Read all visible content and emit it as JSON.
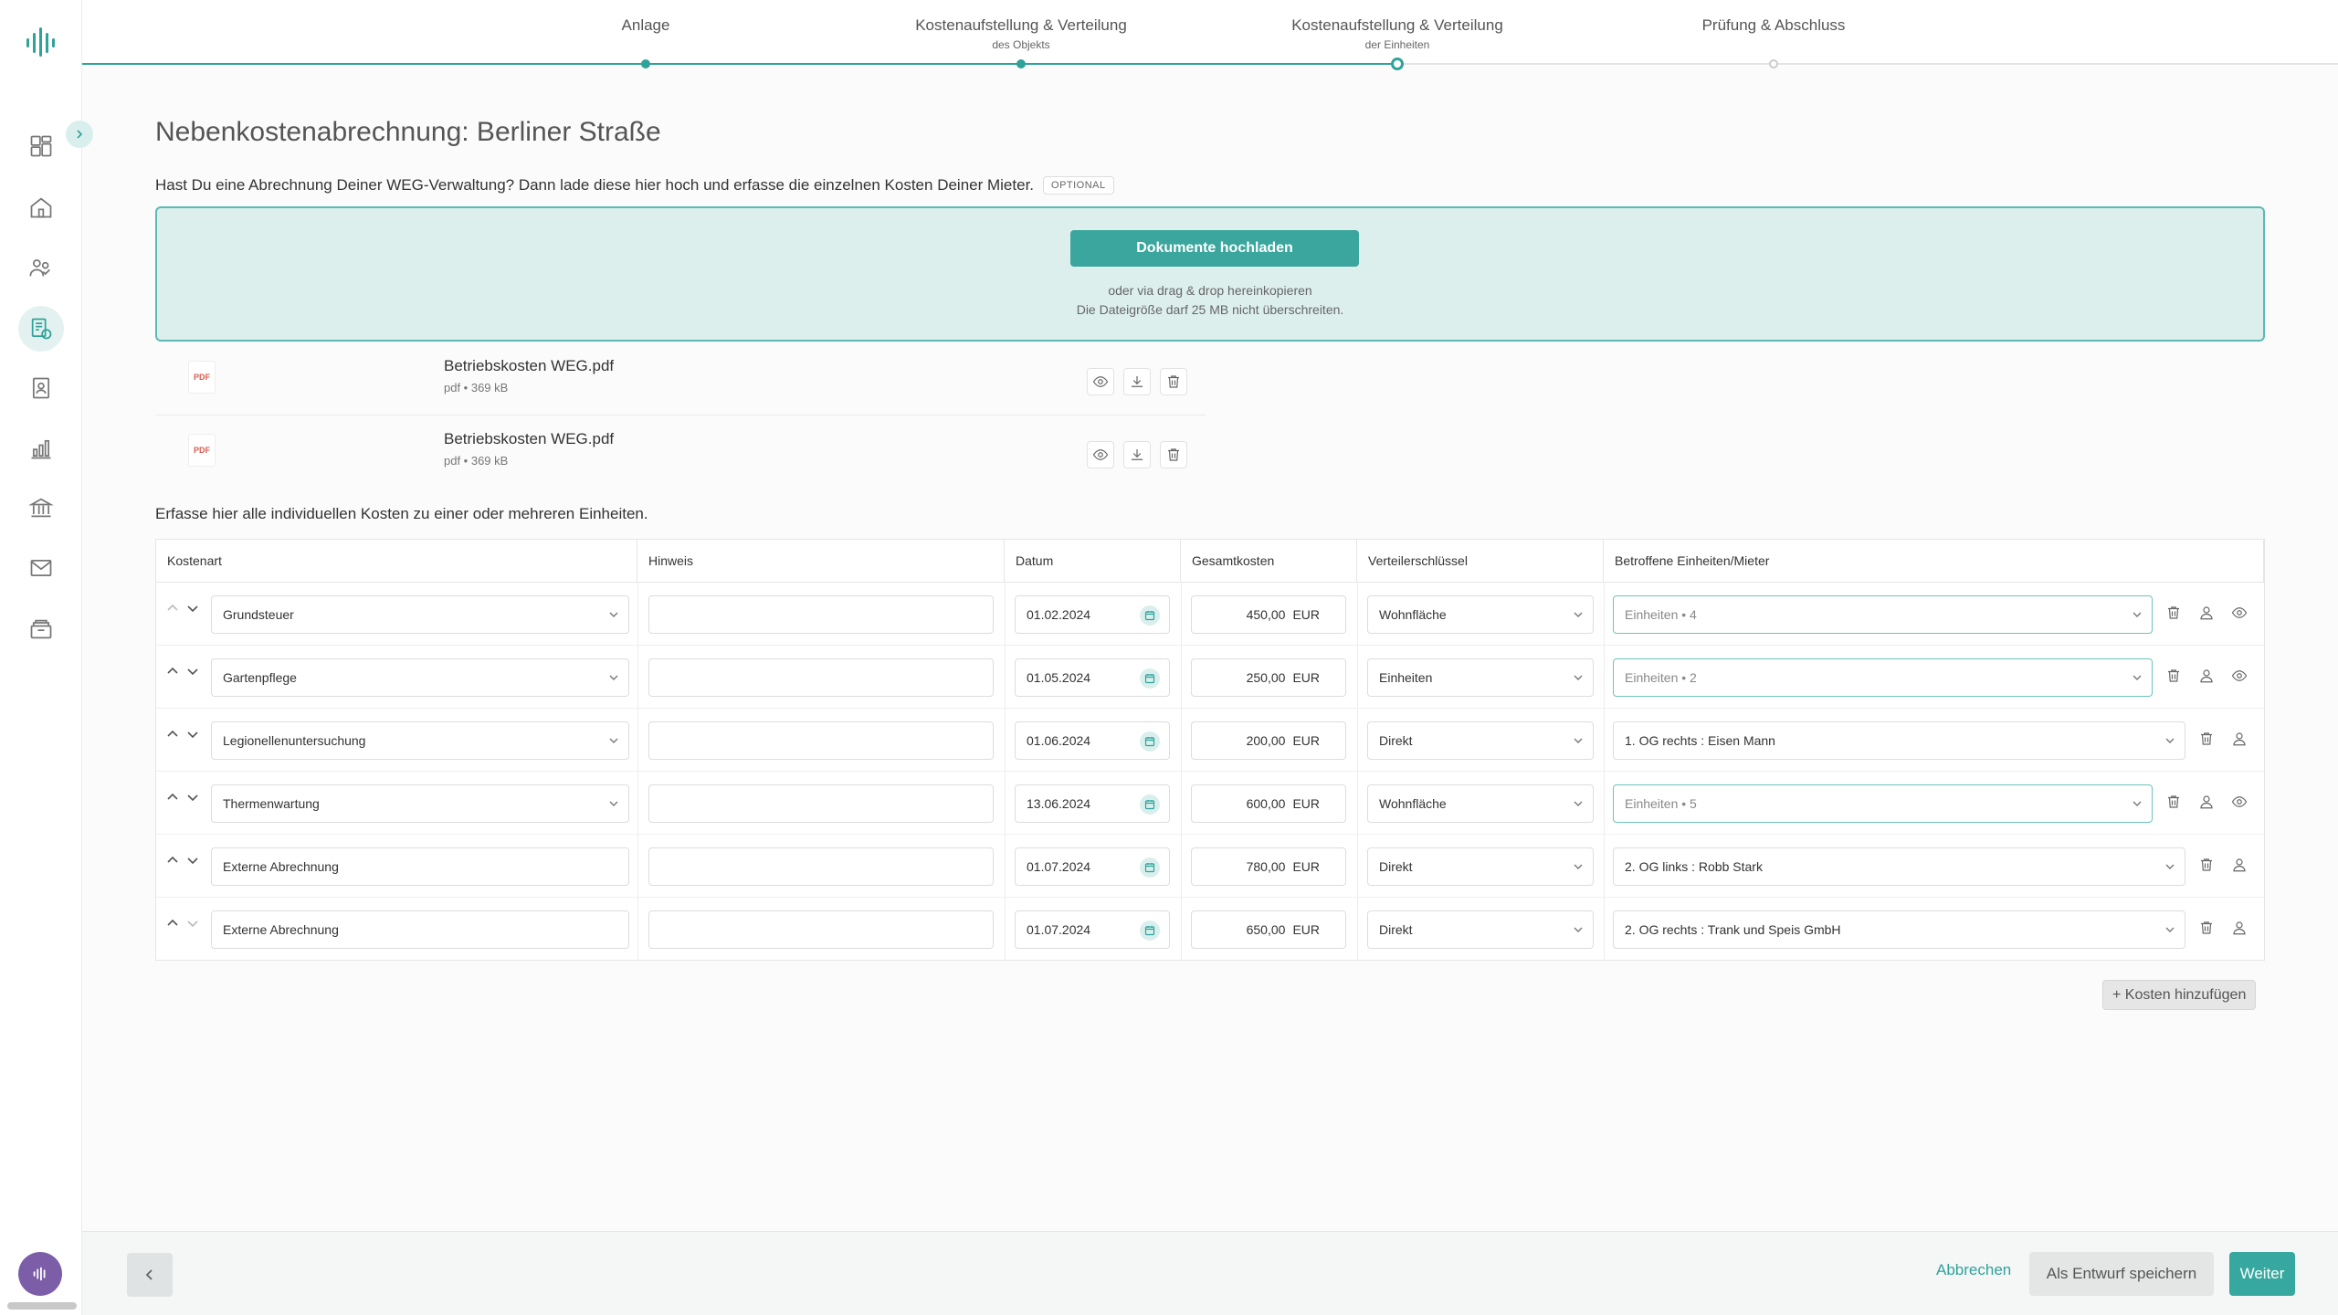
{
  "colors": {
    "accent": "#36a89f",
    "accent_light": "#dcefed",
    "avatar": "#7b5ea7",
    "pdf_red": "#e05a4f"
  },
  "sidebar": {
    "items": [
      {
        "icon": "dashboard-icon"
      },
      {
        "icon": "home-icon"
      },
      {
        "icon": "tenants-icon"
      },
      {
        "icon": "utility-billing-icon",
        "active": true
      },
      {
        "icon": "contacts-icon"
      },
      {
        "icon": "statistics-icon"
      },
      {
        "icon": "bank-icon"
      },
      {
        "icon": "mail-icon"
      },
      {
        "icon": "archive-icon"
      }
    ]
  },
  "stepper": {
    "steps": [
      {
        "label": "Anlage",
        "sub": "",
        "state": "done"
      },
      {
        "label": "Kostenaufstellung & Verteilung",
        "sub": "des Objekts",
        "state": "done"
      },
      {
        "label": "Kostenaufstellung & Verteilung",
        "sub": "der Einheiten",
        "state": "current"
      },
      {
        "label": "Prüfung & Abschluss",
        "sub": "",
        "state": "future"
      }
    ]
  },
  "page": {
    "title": "Nebenkostenabrechnung: Berliner Straße",
    "intro": "Hast Du eine Abrechnung Deiner WEG-Verwaltung? Dann lade diese hier hoch und erfasse die einzelnen Kosten Deiner Mieter.",
    "optional_badge": "OPTIONAL",
    "table_intro": "Erfasse hier alle individuellen Kosten zu einer oder mehreren Einheiten."
  },
  "upload": {
    "button": "Dokumente hochladen",
    "hint1": "oder via drag & drop hereinkopieren",
    "hint2": "Die Dateigröße darf 25 MB nicht überschreiten."
  },
  "files": [
    {
      "name": "Betriebskosten WEG.pdf",
      "meta": "pdf • 369 kB",
      "type_label": "PDF"
    },
    {
      "name": "Betriebskosten WEG.pdf",
      "meta": "pdf • 369 kB",
      "type_label": "PDF"
    }
  ],
  "table": {
    "headers": [
      "Kostenart",
      "Hinweis",
      "Datum",
      "Gesamtkosten",
      "Verteilerschlüssel",
      "Betroffene Einheiten/Mieter"
    ],
    "currency": "EUR",
    "rows": [
      {
        "kostenart": "Grundsteuer",
        "select": true,
        "hinweis": "",
        "datum": "01.02.2024",
        "betrag": "450,00",
        "schluessel": "Wohnfläche",
        "einheiten": "Einheiten • 4",
        "multi": true
      },
      {
        "kostenart": "Gartenpflege",
        "select": true,
        "hinweis": "",
        "datum": "01.05.2024",
        "betrag": "250,00",
        "schluessel": "Einheiten",
        "einheiten": "Einheiten • 2",
        "multi": true
      },
      {
        "kostenart": "Legionellenuntersuchung",
        "select": true,
        "hinweis": "",
        "datum": "01.06.2024",
        "betrag": "200,00",
        "schluessel": "Direkt",
        "einheiten": "1. OG rechts : Eisen Mann",
        "multi": false
      },
      {
        "kostenart": "Thermenwartung",
        "select": true,
        "hinweis": "",
        "datum": "13.06.2024",
        "betrag": "600,00",
        "schluessel": "Wohnfläche",
        "einheiten": "Einheiten • 5",
        "multi": true
      },
      {
        "kostenart": "Externe Abrechnung",
        "select": false,
        "hinweis": "",
        "datum": "01.07.2024",
        "betrag": "780,00",
        "schluessel": "Direkt",
        "einheiten": "2. OG links : Robb Stark",
        "multi": false
      },
      {
        "kostenart": "Externe Abrechnung",
        "select": false,
        "hinweis": "",
        "datum": "01.07.2024",
        "betrag": "650,00",
        "schluessel": "Direkt",
        "einheiten": "2. OG rechts : Trank und Speis GmbH",
        "multi": false
      }
    ],
    "add_button": "+ Kosten hinzufügen"
  },
  "footer": {
    "cancel": "Abbrechen",
    "draft": "Als Entwurf speichern",
    "next": "Weiter"
  }
}
